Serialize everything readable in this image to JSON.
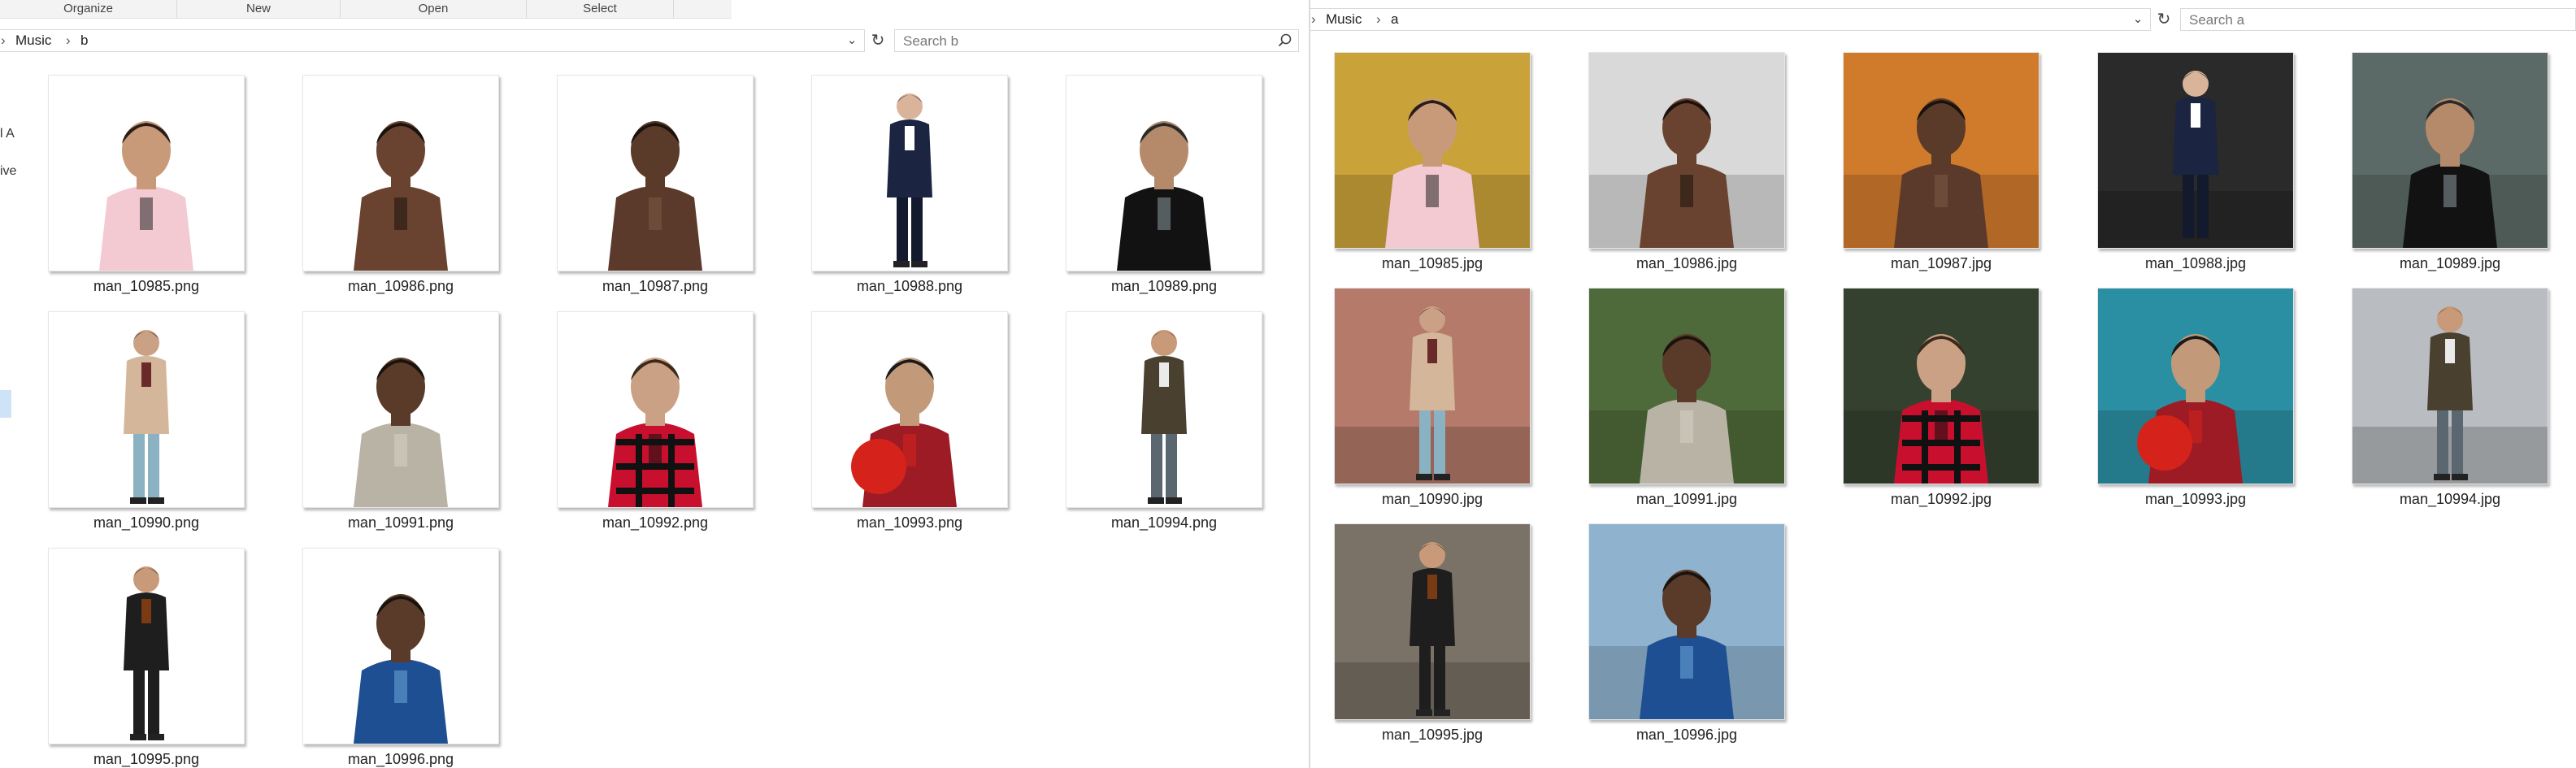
{
  "left_window": {
    "ribbon": [
      {
        "label": "Organize"
      },
      {
        "label": "New"
      },
      {
        "label": "Open"
      },
      {
        "label": "Select"
      }
    ],
    "breadcrumb": [
      "Music",
      "b"
    ],
    "search_placeholder": "Search b",
    "nav_fragments": [
      "l A",
      "ive"
    ],
    "files": [
      {
        "name": "man_10985.png",
        "subject": "pink-hoodie",
        "background": "#ffffff"
      },
      {
        "name": "man_10986.png",
        "subject": "shirtless",
        "background": "#ffffff"
      },
      {
        "name": "man_10987.png",
        "subject": "brown-jacket",
        "background": "#ffffff"
      },
      {
        "name": "man_10988.png",
        "subject": "navy-suit",
        "background": "#ffffff"
      },
      {
        "name": "man_10989.png",
        "subject": "black-tee-bike",
        "background": "#ffffff"
      },
      {
        "name": "man_10990.png",
        "subject": "beige-blazer-jeans",
        "background": "#ffffff"
      },
      {
        "name": "man_10991.png",
        "subject": "plaid-shirt",
        "background": "#ffffff"
      },
      {
        "name": "man_10992.png",
        "subject": "red-flannel",
        "background": "#ffffff"
      },
      {
        "name": "man_10993.png",
        "subject": "red-shirt-ball",
        "background": "#ffffff"
      },
      {
        "name": "man_10994.png",
        "subject": "sitting-sneakers",
        "background": "#ffffff"
      },
      {
        "name": "man_10995.png",
        "subject": "violinist",
        "background": "#ffffff"
      },
      {
        "name": "man_10996.png",
        "subject": "blue-suit",
        "background": "#ffffff"
      }
    ]
  },
  "right_window": {
    "breadcrumb": [
      "Music",
      "a"
    ],
    "search_placeholder": "Search a",
    "files": [
      {
        "name": "man_10985.jpg",
        "subject": "pink-hoodie",
        "background": "#c9a23a"
      },
      {
        "name": "man_10986.jpg",
        "subject": "shirtless",
        "background": "#d9d9d9"
      },
      {
        "name": "man_10987.jpg",
        "subject": "brown-jacket",
        "background": "#d07a2c"
      },
      {
        "name": "man_10988.jpg",
        "subject": "navy-suit",
        "background": "#2a2a2a"
      },
      {
        "name": "man_10989.jpg",
        "subject": "black-tee-bike",
        "background": "#5b6a66"
      },
      {
        "name": "man_10990.jpg",
        "subject": "beige-blazer-jeans",
        "background": "#b57a6a"
      },
      {
        "name": "man_10991.jpg",
        "subject": "plaid-shirt",
        "background": "#4f6a3a"
      },
      {
        "name": "man_10992.jpg",
        "subject": "red-flannel",
        "background": "#34412f"
      },
      {
        "name": "man_10993.jpg",
        "subject": "red-shirt-ball",
        "background": "#2b8fa3"
      },
      {
        "name": "man_10994.jpg",
        "subject": "sitting-sneakers",
        "background": "#b9bcc0"
      },
      {
        "name": "man_10995.jpg",
        "subject": "violinist",
        "background": "#7a7266"
      },
      {
        "name": "man_10996.jpg",
        "subject": "blue-suit",
        "background": "#8fb3cf"
      }
    ]
  },
  "icons": {
    "breadcrumb_separator": "chevron-right-icon",
    "address_dropdown": "chevron-down-icon",
    "refresh": "refresh-icon",
    "search": "search-icon"
  }
}
